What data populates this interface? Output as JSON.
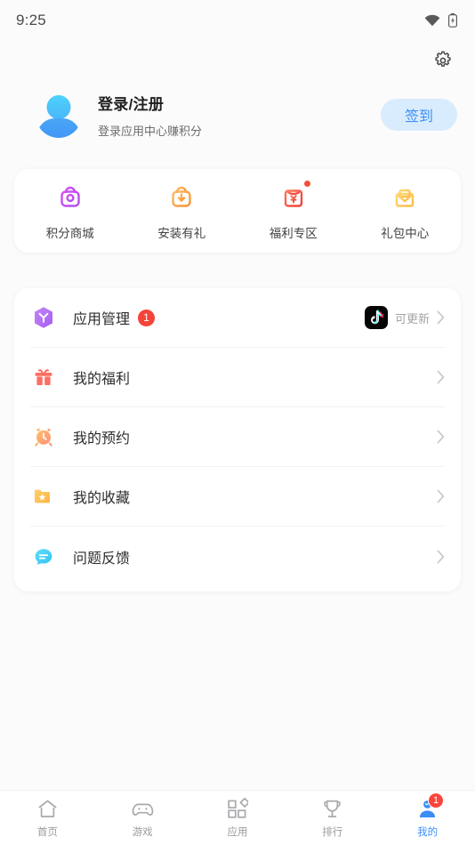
{
  "statusbar": {
    "time": "9:25",
    "wifi_icon": "wifi-icon",
    "battery_icon": "battery-icon"
  },
  "header": {
    "settings_icon": "gear-icon",
    "avatar_icon": "avatar-placeholder-icon",
    "title": "登录/注册",
    "subtitle": "登录应用中心赚积分",
    "signin_label": "签到",
    "signin_bg": "#d9ecfd",
    "signin_color": "#3c8ef6"
  },
  "quick_actions": [
    {
      "label": "积分商城",
      "icon": "points-mall-bag-icon",
      "color": "#c04ef0",
      "badge": false
    },
    {
      "label": "安装有礼",
      "icon": "install-gift-bag-icon",
      "color": "#f6a43c",
      "badge": false
    },
    {
      "label": "福利专区",
      "icon": "red-envelope-yuan-icon",
      "color": "#f4574a",
      "badge": true
    },
    {
      "label": "礼包中心",
      "icon": "gift-pack-box-icon",
      "color": "#f9c council"
    }
  ],
  "menu": [
    {
      "label": "应用管理",
      "icon": "app-manage-hexagon-icon",
      "badge": "1",
      "right_app_icon": "tiktok-icon",
      "right_text": "可更新",
      "chevron": "chevron-right-icon"
    },
    {
      "label": "我的福利",
      "icon": "gift-box-icon",
      "badge": null,
      "right_text": null,
      "chevron": "chevron-right-icon"
    },
    {
      "label": "我的预约",
      "icon": "alarm-clock-icon",
      "badge": null,
      "right_text": null,
      "chevron": "chevron-right-icon"
    },
    {
      "label": "我的收藏",
      "icon": "folder-star-icon",
      "badge": null,
      "right_text": null,
      "chevron": "chevron-right-icon"
    },
    {
      "label": "问题反馈",
      "icon": "feedback-bubble-icon",
      "badge": null,
      "right_text": null,
      "chevron": "chevron-right-icon"
    }
  ],
  "bottomnav": {
    "active_color": "#3c8ef6",
    "inactive_color": "#9b9b9e",
    "items": [
      {
        "label": "首页",
        "icon": "home-icon",
        "active": false,
        "badge": null
      },
      {
        "label": "游戏",
        "icon": "gamepad-icon",
        "active": false,
        "badge": null
      },
      {
        "label": "应用",
        "icon": "apps-grid-icon",
        "active": false,
        "badge": null
      },
      {
        "label": "排行",
        "icon": "trophy-icon",
        "active": false,
        "badge": null
      },
      {
        "label": "我的",
        "icon": "profile-person-icon",
        "active": true,
        "badge": "1"
      }
    ]
  }
}
